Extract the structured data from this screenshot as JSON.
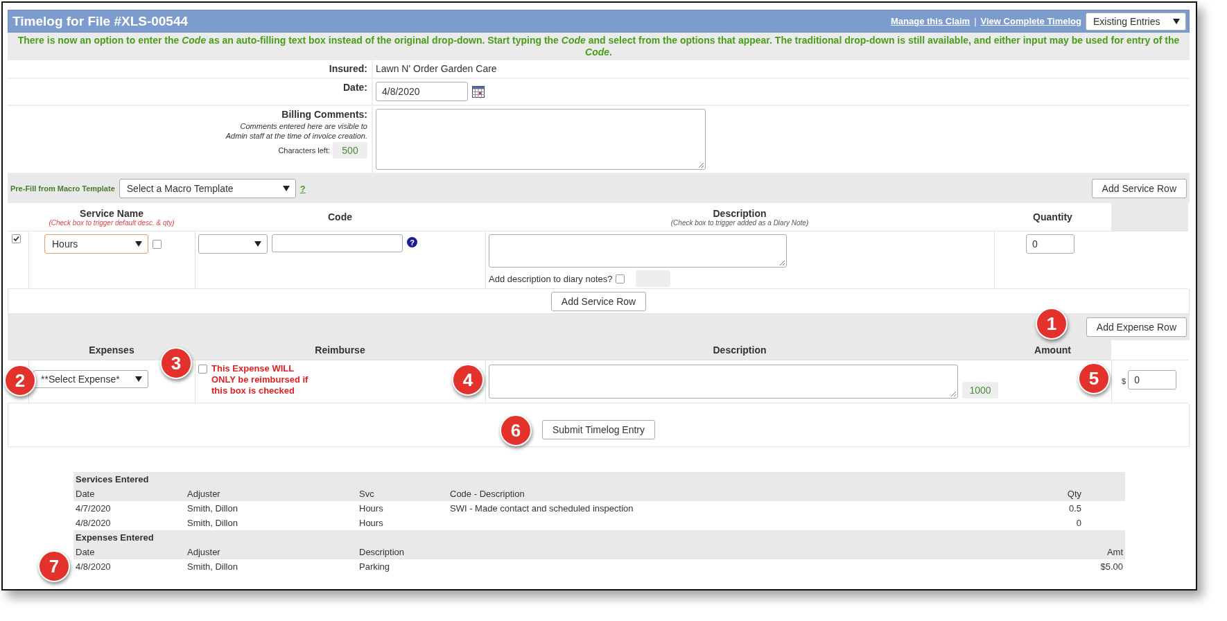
{
  "window": {
    "title": "Timelog for File #XLS-00544"
  },
  "header_links": [
    "Manage this Claim",
    "View Complete Timelog"
  ],
  "header_separator": "|",
  "entries_select": {
    "value": "Existing Entries"
  },
  "notice": "There is now an option to enter the *Code* as an auto-filling text box instead of the original drop-down. Start typing the *Code* and select from the options that appear. The traditional drop-down is still available, and either input may be used for entry of the *Code*.",
  "insured": {
    "label": "Insured:",
    "value": "Lawn N' Order Garden Care"
  },
  "date": {
    "label": "Date:",
    "value": "4/8/2020"
  },
  "billing": {
    "label": "Billing Comments:",
    "hint": "Comments entered here are visible to\nAdmin staff at the time of invoice creation.",
    "chars_label": "Characters left:",
    "chars_left": "500"
  },
  "macro": {
    "label": "Pre-Fill from Macro Template",
    "select": "Select a Macro Template",
    "help": "?",
    "add_button": "Add Service Row"
  },
  "services": {
    "columns": [
      {
        "title": "Service Name",
        "hint": "(Check box to trigger default desc. & qty)"
      },
      {
        "title": "Code"
      },
      {
        "title": "Description",
        "hint": "(Check box to trigger added as a Diary Note)"
      },
      {
        "title": "Quantity"
      }
    ],
    "rows": [
      {
        "checked": true,
        "service": "Hours",
        "default_checked": false,
        "code_help": "?",
        "diary_label": "Add description to diary notes?",
        "diary_checked": false,
        "quantity": "0"
      }
    ],
    "add_button": "Add Service Row"
  },
  "expenses": {
    "add_button": "Add Expense Row",
    "columns": [
      "Expenses",
      "Reimburse",
      "Description",
      "Amount"
    ],
    "rows": [
      {
        "expense": "**Select Expense*",
        "reimburse_checked": false,
        "reimburse_note": "This Expense WILL ONLY be reimbursed if this box is checked",
        "chars_left": "1000",
        "currency": "$",
        "amount": "0"
      }
    ]
  },
  "submit_button": "Submit Timelog Entry",
  "services_entered": {
    "title": "Services Entered",
    "columns": [
      "Date",
      "Adjuster",
      "Svc",
      "Code - Description",
      "Qty"
    ],
    "rows": [
      {
        "date": "4/7/2020",
        "adjuster": "Smith, Dillon",
        "svc": "Hours",
        "code_description": "SWI - Made contact and scheduled inspection",
        "qty": "0.5"
      },
      {
        "date": "4/8/2020",
        "adjuster": "Smith, Dillon",
        "svc": "Hours",
        "qty": "0"
      }
    ]
  },
  "expenses_entered": {
    "title": "Expenses Entered",
    "columns": [
      "Date",
      "Adjuster",
      "Description",
      "Amt"
    ],
    "rows": [
      {
        "date": "4/8/2020",
        "adjuster": "Smith, Dillon",
        "description": "Parking",
        "amount": "$5.00"
      }
    ]
  },
  "callouts": [
    "1",
    "2",
    "3",
    "4",
    "5",
    "6",
    "7"
  ]
}
